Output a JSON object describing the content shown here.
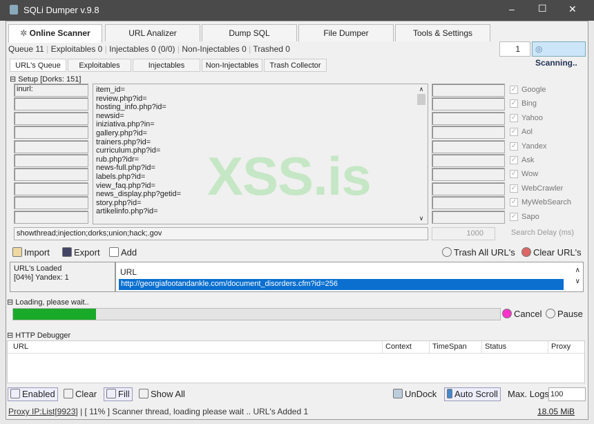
{
  "window": {
    "title": "SQLi Dumper v.9.8",
    "controls": [
      "–",
      "☐",
      "✕"
    ]
  },
  "main_tabs": [
    "Online Scanner",
    "URL Analizer",
    "Dump SQL",
    "File Dumper",
    "Tools & Settings"
  ],
  "stats": {
    "queue": "Queue 11",
    "exploitables": "Exploitables 0",
    "injectables": "Injectables 0 (0/0)",
    "non_injectables": "Non-Injectables 0",
    "trashed": "Trashed 0"
  },
  "threads": "1",
  "scan_button": "Scanning..",
  "sub_tabs": [
    "URL's Queue",
    "Exploitables",
    "Injectables",
    "Non-Injectables",
    "Trash Collector"
  ],
  "setup": {
    "label": "Setup [Dorks: 151]",
    "prefix": "inurl:",
    "dorks": [
      "item_id=",
      "review.php?id=",
      "hosting_info.php?id=",
      "newsid=",
      "iniziativa.php?in=",
      "gallery.php?id=",
      "trainers.php?id=",
      "curriculum.php?id=",
      "rub.php?idr=",
      "news-full.php?id=",
      "labels.php?id=",
      "view_faq.php?id=",
      "news_display.php?getid=",
      "story.php?id=",
      "artikelinfo.php?id="
    ],
    "engines": [
      "Google",
      "Bing",
      "Yahoo",
      "Aol",
      "Yandex",
      "Ask",
      "Wow",
      "WebCrawler",
      "MyWebSearch",
      "Sapo"
    ],
    "keywords": "showthread;injection;dorks;union;hack;.gov",
    "delay": "1000",
    "delay_label": "Search Delay (ms)"
  },
  "watermark": "XSS.is",
  "toolbar": {
    "import": "Import",
    "export": "Export",
    "add": "Add",
    "trash_all": "Trash All URL's",
    "clear": "Clear URL's"
  },
  "urls": {
    "loaded_label": "URL's Loaded",
    "loaded_status": "[04%] Yandex: 1",
    "header": "URL",
    "rows": [
      "http://georgiafootandankle.com/document_disorders.cfm?id=256"
    ]
  },
  "loading": {
    "label": "Loading, please wait..",
    "progress": 0.17,
    "cancel": "Cancel",
    "pause": "Pause",
    "color": "#1aaa2a"
  },
  "debugger": {
    "label": "HTTP Debugger",
    "columns": [
      "URL",
      "Context",
      "TimeSpan",
      "Status",
      "Proxy"
    ],
    "enabled": "Enabled",
    "clear": "Clear",
    "fill": "Fill",
    "show_all": "Show All",
    "undock": "UnDock",
    "auto_scroll": "Auto Scroll",
    "max_logs_label": "Max. Logs:",
    "max_logs": "100"
  },
  "status": {
    "proxy": "Proxy IP:List[9923]",
    "message": "[ 11% ] Scanner thread, loading please wait .. URL's Added 1",
    "memory": "18.05 MiB"
  }
}
